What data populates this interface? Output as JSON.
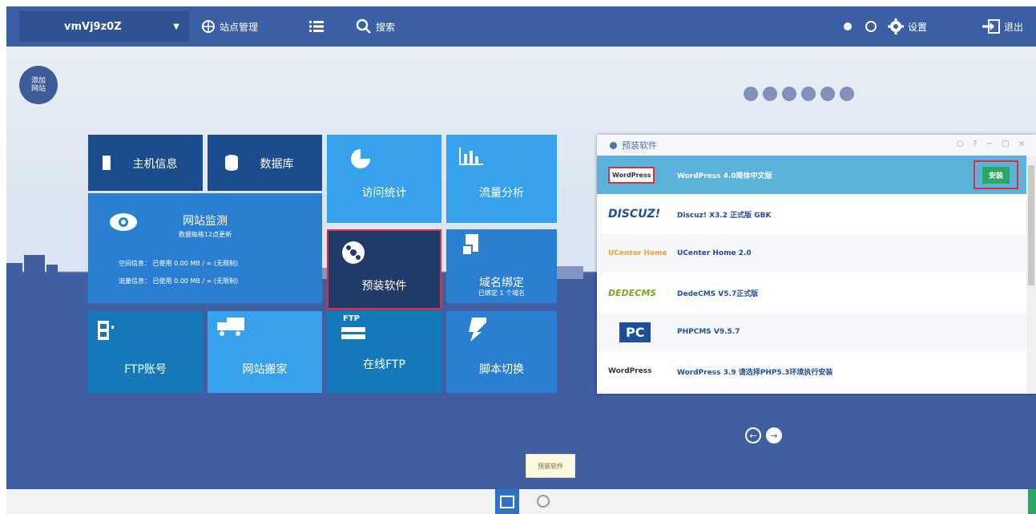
{
  "topbar": {
    "site_name": "vmVj9z0Z",
    "site_manage": "站点管理",
    "search": "搜索",
    "settings": "设置",
    "logout": "退出"
  },
  "add_site": "添加网站",
  "tiles": {
    "host_info": "主机信息",
    "database": "数据库",
    "visit_stats": "访问统计",
    "traffic": "流量分析",
    "monitor": "网站监测",
    "monitor_sub": "数据每格12点更新",
    "space_info": "空间信息： 已使用 0.00 MB / ∞ (无限制)",
    "traffic_info": "流量信息： 已使用 0.00 MB / ∞ (无限制)",
    "preinstall": "预装软件",
    "domain": "域名绑定",
    "domain_sub": "已绑定 1 个域名",
    "ftp_account": "FTP账号",
    "site_move": "网站搬家",
    "online_ftp": "在线FTP",
    "script_switch": "脚本切换",
    "ftp_tag": "FTP"
  },
  "panel": {
    "title": "预装软件",
    "install_label": "安装",
    "items": [
      {
        "logo": "WordPress",
        "name": "WordPress 4.0简体中文版"
      },
      {
        "logo": "DISCUZ!",
        "name": "Discuz! X3.2 正式版 GBK"
      },
      {
        "logo": "UCenter Home",
        "name": "UCenter Home 2.0"
      },
      {
        "logo": "DEDECMS",
        "name": "DedeCMS V5.7正式版"
      },
      {
        "logo": "PC",
        "name": "PHPCMS V9.5.7"
      },
      {
        "logo": "WordPress",
        "name": "WordPress 3.9 请选择PHP5.3环境执行安装"
      }
    ]
  },
  "tooltip": "预装软件",
  "colors": {
    "accent": "#3b5fa4",
    "highlight": "#d9303a",
    "install": "#2aa863"
  }
}
